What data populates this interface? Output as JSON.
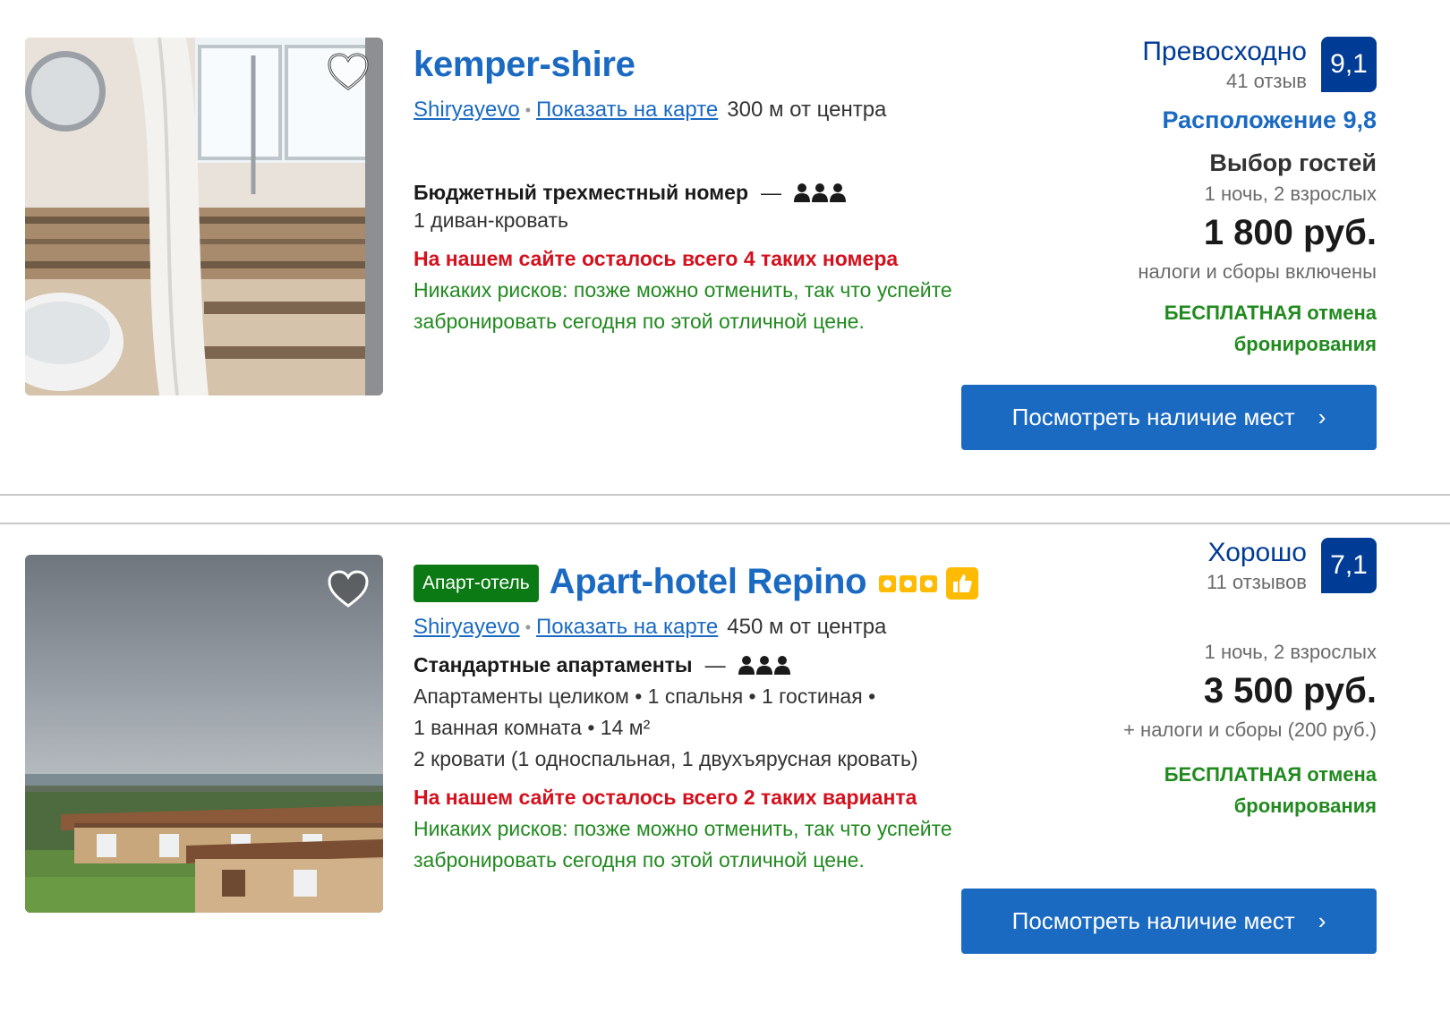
{
  "listings": [
    {
      "title": "kemper-shire",
      "type_badge": "",
      "location": "Shiryayevo",
      "map_link": "Показать на карте",
      "distance": "300 м от центра",
      "room_name": "Бюджетный трехместный номер",
      "room_details": [
        "1 диван-кровать"
      ],
      "scarcity": "На нашем сайте осталось всего 4 таких номера",
      "no_risk": "Никаких рисков: позже можно отменить, так что успейте забронировать сегодня по этой отличной цене.",
      "review_word": "Превосходно",
      "review_count": "41 отзыв",
      "score": "9,1",
      "location_score": "Расположение 9,8",
      "guest_choice": "Выбор гостей",
      "nights": "1 ночь, 2 взрослых",
      "price": "1 800 руб.",
      "taxes": "налоги и сборы включены",
      "free_cancel_line1": "БЕСПЛАТНАЯ отмена",
      "free_cancel_line2": "бронирования",
      "cta": "Посмотреть наличие мест",
      "heart_color": "#333333"
    },
    {
      "title": "Apart-hotel Repino",
      "type_badge": "Апарт-отель",
      "stars": 3,
      "location": "Shiryayevo",
      "map_link": "Показать на карте",
      "distance": "450 м от центра",
      "room_name": "Стандартные апартаменты",
      "room_details": [
        "Апартаменты целиком • 1 спальня • 1 гостиная •",
        "1 ванная комната • 14 м²",
        "2 кровати (1 односпальная, 1 двухъярусная кровать)"
      ],
      "scarcity": "На нашем сайте осталось всего 2 таких варианта",
      "no_risk": "Никаких рисков: позже можно отменить, так что успейте забронировать сегодня по этой отличной цене.",
      "review_word": "Хорошо",
      "review_count": "11 отзывов",
      "score": "7,1",
      "nights": "1 ночь, 2 взрослых",
      "price": "3 500 руб.",
      "taxes": "+ налоги и сборы (200 руб.)",
      "free_cancel_line1": "БЕСПЛАТНАЯ отмена",
      "free_cancel_line2": "бронирования",
      "cta": "Посмотреть наличие мест"
    }
  ],
  "colors": {
    "link_blue": "#1b6ac2",
    "score_navy": "#003b95",
    "scarcity_red": "#d4111e",
    "green": "#218a1f",
    "badge_green": "#0b7a14",
    "star_yellow": "#febb02"
  },
  "icons": {
    "favorite": "heart-icon",
    "occupancy": "people-icon",
    "preferred": "thumbs-up-icon",
    "next": "chevron-right-icon"
  }
}
